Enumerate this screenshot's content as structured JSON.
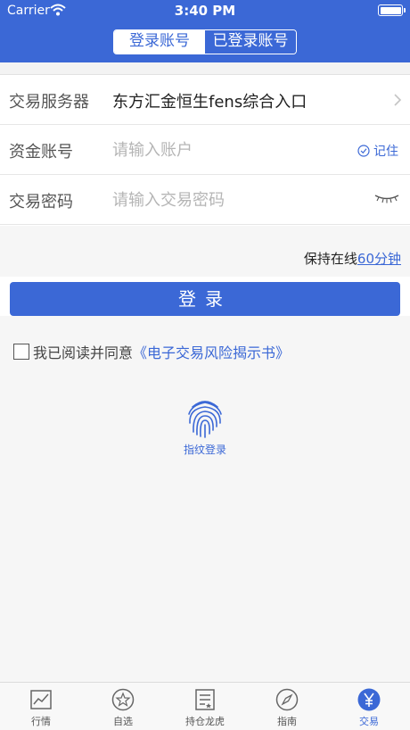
{
  "status_bar": {
    "carrier": "Carrier",
    "time": "3:40 PM"
  },
  "segment": {
    "tabs": [
      "登录账号",
      "已登录账号"
    ],
    "active_index": 0
  },
  "form": {
    "server": {
      "label": "交易服务器",
      "value": "东方汇金恒生fens综合入口"
    },
    "account": {
      "label": "资金账号",
      "placeholder": "请输入账户",
      "remember_label": "记住"
    },
    "password": {
      "label": "交易密码",
      "placeholder": "请输入交易密码"
    }
  },
  "online": {
    "prefix": "保持在线",
    "duration": "60分钟"
  },
  "login_button": "登录",
  "agreement": {
    "text": "我已阅读并同意",
    "link": "《电子交易风险揭示书》"
  },
  "fingerprint": {
    "label": "指纹登录"
  },
  "tabbar": {
    "items": [
      {
        "label": "行情",
        "icon": "chart-icon"
      },
      {
        "label": "自选",
        "icon": "star-icon"
      },
      {
        "label": "持仓龙虎",
        "icon": "list-icon"
      },
      {
        "label": "指南",
        "icon": "compass-icon"
      },
      {
        "label": "交易",
        "icon": "yen-icon"
      }
    ],
    "active_index": 4
  },
  "colors": {
    "primary": "#3b68d6",
    "background": "#f6f6f6"
  }
}
